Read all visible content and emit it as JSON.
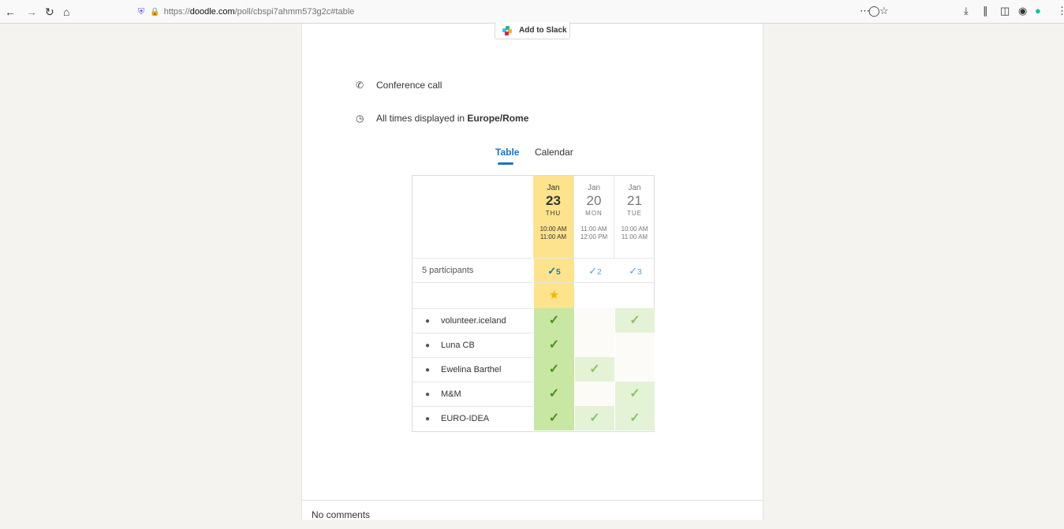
{
  "browser": {
    "url_prefix": "https://",
    "url_domain": "doodle.com",
    "url_path": "/poll/cbspi7ahmm573g2c#table",
    "nav_icons": [
      "back-icon",
      "forward-icon",
      "reload-icon",
      "home-icon"
    ],
    "toolbar_icons": [
      "page-actions-icon",
      "pocket-icon",
      "bookmark-star-icon",
      "downloads-icon",
      "library-icon",
      "sidebar-icon",
      "extension-icon",
      "grammarly-icon",
      "menu-icon"
    ]
  },
  "slack": {
    "label": "Add to Slack"
  },
  "info": {
    "location": "Conference call",
    "timezone_prefix": "All times displayed in ",
    "timezone": "Europe/Rome"
  },
  "tabs": [
    {
      "label": "Table",
      "active": true
    },
    {
      "label": "Calendar",
      "active": false
    }
  ],
  "poll": {
    "participants_label": "5 participants",
    "options": [
      {
        "month": "Jan",
        "day": "23",
        "weekday": "THU",
        "start": "10:00 AM",
        "end": "11:00 AM",
        "count": "5",
        "best": true
      },
      {
        "month": "Jan",
        "day": "20",
        "weekday": "MON",
        "start": "11:00 AM",
        "end": "12:00 PM",
        "count": "2",
        "best": false
      },
      {
        "month": "Jan",
        "day": "21",
        "weekday": "TUE",
        "start": "10:00 AM",
        "end": "11:00 AM",
        "count": "3",
        "best": false
      }
    ],
    "participants": [
      {
        "name": "volunteer.iceland",
        "votes": [
          true,
          false,
          true
        ]
      },
      {
        "name": "Luna CB",
        "votes": [
          true,
          false,
          false
        ]
      },
      {
        "name": "Ewelina Barthel",
        "votes": [
          true,
          true,
          false
        ]
      },
      {
        "name": "M&M",
        "votes": [
          true,
          false,
          true
        ]
      },
      {
        "name": "EURO-IDEA",
        "votes": [
          true,
          true,
          true
        ]
      }
    ]
  },
  "comments": {
    "label": "No comments"
  },
  "colors": {
    "best_header": "#fde38b",
    "best_cell": "#c7e7a3",
    "yes_cell": "#e4f2d6",
    "no_cell": "#fdfbf8",
    "best_check": "#4f8f1c",
    "yes_check": "#8cc466",
    "count_check": "#1a73c8",
    "star": "#f5b400"
  }
}
